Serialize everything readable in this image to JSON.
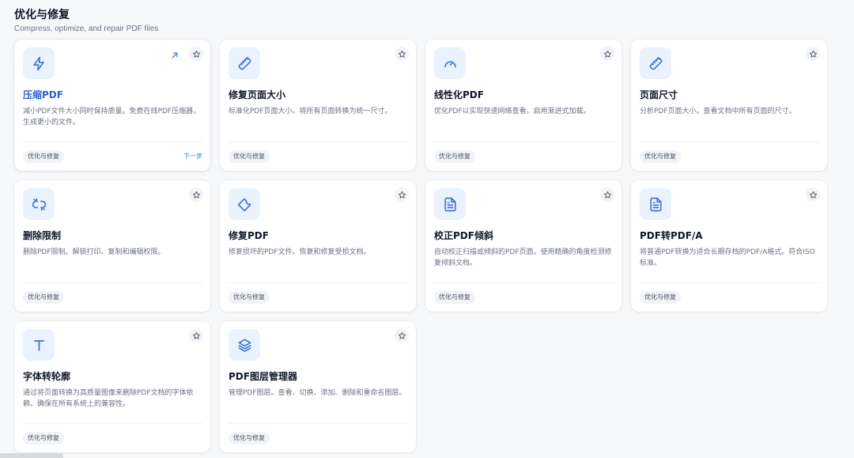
{
  "header": {
    "title": "优化与修复",
    "subtitle": "Compress, optimize, and repair PDF files"
  },
  "cards": [
    {
      "title": "压缩PDF",
      "desc": "减小PDF文件大小同时保持质量。免费在线PDF压缩器，生成更小的文件。",
      "tag": "优化与修复",
      "icon": "lightning-icon",
      "next_label": "下一步"
    },
    {
      "title": "修复页面大小",
      "desc": "标准化PDF页面大小。将所有页面转换为统一尺寸。",
      "tag": "优化与修复",
      "icon": "ruler-icon"
    },
    {
      "title": "线性化PDF",
      "desc": "优化PDF以实现快速网络查看。启用渐进式加载。",
      "tag": "优化与修复",
      "icon": "gauge-icon"
    },
    {
      "title": "页面尺寸",
      "desc": "分析PDF页面大小。查看文档中所有页面的尺寸。",
      "tag": "优化与修复",
      "icon": "ruler-icon"
    },
    {
      "title": "删除限制",
      "desc": "删除PDF限制。解锁打印、复制和编辑权限。",
      "tag": "优化与修复",
      "icon": "unlink-icon"
    },
    {
      "title": "修复PDF",
      "desc": "修复损坏的PDF文件。恢复和修复受损文档。",
      "tag": "优化与修复",
      "icon": "wrench-icon"
    },
    {
      "title": "校正PDF倾斜",
      "desc": "自动校正扫描或倾斜的PDF页面。使用精确的角度检测修复倾斜文档。",
      "tag": "优化与修复",
      "icon": "document-icon"
    },
    {
      "title": "PDF转PDF/A",
      "desc": "将普通PDF转换为适合长期存档的PDF/A格式。符合ISO标准。",
      "tag": "优化与修复",
      "icon": "document-icon"
    },
    {
      "title": "字体转轮廓",
      "desc": "通过将页面转换为高质量图像来删除PDF文档的字体依赖。确保在所有系统上的兼容性。",
      "tag": "优化与修复",
      "icon": "text-t-icon"
    },
    {
      "title": "PDF图层管理器",
      "desc": "管理PDF图层。查看、切换、添加、删除和重命名图层。",
      "tag": "优化与修复",
      "icon": "layers-icon"
    }
  ],
  "colors": {
    "accent": "#3b6fd6",
    "icon_bg": "#eaf2fd",
    "background": "#f7f8fa"
  }
}
